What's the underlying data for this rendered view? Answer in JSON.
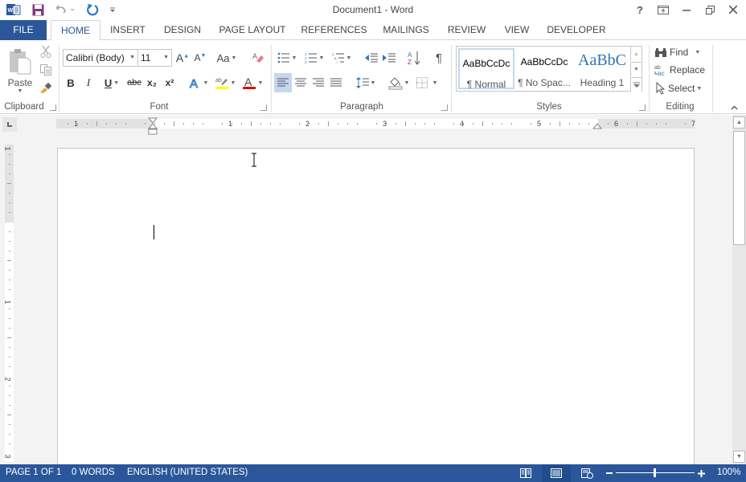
{
  "window": {
    "title": "Document1 - Word",
    "controls": [
      "help",
      "ribbon-display-options",
      "minimize",
      "restore",
      "close"
    ],
    "help_label": "?"
  },
  "quick_access": {
    "icons": [
      "word-logo-icon",
      "save-icon",
      "undo-icon",
      "redo-icon",
      "customize-qat-icon"
    ]
  },
  "tabs": [
    {
      "label": "FILE"
    },
    {
      "label": "HOME",
      "active": true
    },
    {
      "label": "INSERT"
    },
    {
      "label": "DESIGN"
    },
    {
      "label": "PAGE LAYOUT"
    },
    {
      "label": "REFERENCES"
    },
    {
      "label": "MAILINGS"
    },
    {
      "label": "REVIEW"
    },
    {
      "label": "VIEW"
    },
    {
      "label": "DEVELOPER"
    }
  ],
  "ribbon": {
    "clipboard": {
      "label": "Clipboard",
      "paste_label": "Paste"
    },
    "font": {
      "label": "Font",
      "font_name": "Calibri (Body)",
      "font_size": "11",
      "change_case_label": "Aa",
      "bold": "B",
      "italic": "I",
      "underline": "U",
      "strikethrough": "abc",
      "subscript": "x₂",
      "superscript": "x²",
      "highlight_color": "#ffff00",
      "font_color": "#e00000"
    },
    "paragraph": {
      "label": "Paragraph",
      "pilcrow": "¶",
      "active_alignment": "left"
    },
    "styles": {
      "label": "Styles",
      "items": [
        {
          "sample": "AaBbCcDc",
          "name": "¶ Normal",
          "selected": true
        },
        {
          "sample": "AaBbCcDc",
          "name": "¶ No Spac..."
        },
        {
          "sample": "AaBbC",
          "name": "Heading 1"
        }
      ]
    },
    "editing": {
      "label": "Editing",
      "find_label": "Find",
      "replace_label": "Replace",
      "select_label": "Select"
    }
  },
  "ruler": {
    "horizontal_labels": [
      "1",
      "1",
      "2",
      "3",
      "4",
      "5",
      "6",
      "7"
    ],
    "vertical_labels": [
      "1",
      "1",
      "2",
      "3"
    ]
  },
  "statusbar": {
    "page": "PAGE 1 OF 1",
    "words": "0 WORDS",
    "language": "ENGLISH (UNITED STATES)",
    "zoom": "100%",
    "zoom_percent": 100,
    "active_view": "print-layout"
  },
  "colors": {
    "accent": "#2b579a",
    "heading_style": "#2e74b5"
  }
}
